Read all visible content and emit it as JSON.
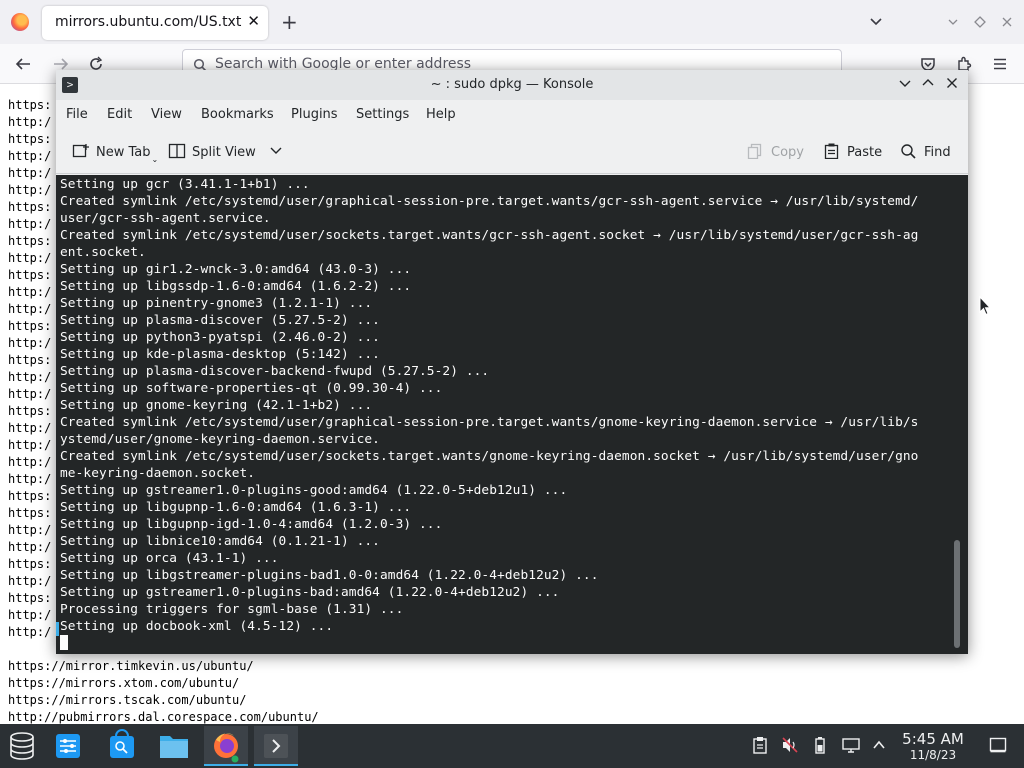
{
  "browser": {
    "tab_title": "mirrors.ubuntu.com/US.txt",
    "tab_close": "✕",
    "new_tab": "+",
    "url_placeholder": "Search with Google or enter address",
    "page_lines": [
      "https:",
      "http:/",
      "https:",
      "http:/",
      "http:/",
      "http:/",
      "https:",
      "http:/",
      "https:",
      "http:/",
      "https:",
      "http:/",
      "http:/",
      "https:",
      "http:/",
      "https:",
      "http:/",
      "http:/",
      "https:",
      "http:/",
      "http:/",
      "http:/",
      "http:/",
      "https:",
      "https:",
      "http:/",
      "http:/",
      "https:",
      "http:/",
      "https:",
      "http:/",
      "http:/"
    ],
    "page_lines_bottom": [
      "https://mirror.timkevin.us/ubuntu/",
      "https://mirrors.xtom.com/ubuntu/",
      "https://mirrors.tscak.com/ubuntu/",
      "http://pubmirrors.dal.corespace.com/ubuntu/"
    ]
  },
  "konsole": {
    "title": "~ : sudo dpkg — Konsole",
    "menu": [
      "File",
      "Edit",
      "View",
      "Bookmarks",
      "Plugins",
      "Settings",
      "Help"
    ],
    "toolbar": {
      "new_tab": "New Tab",
      "split_view": "Split View",
      "copy": "Copy",
      "paste": "Paste",
      "find": "Find"
    },
    "terminal_lines": [
      "Setting up gcr (3.41.1-1+b1) ...",
      "Created symlink /etc/systemd/user/graphical-session-pre.target.wants/gcr-ssh-agent.service → /usr/lib/systemd/",
      "user/gcr-ssh-agent.service.",
      "Created symlink /etc/systemd/user/sockets.target.wants/gcr-ssh-agent.socket → /usr/lib/systemd/user/gcr-ssh-ag",
      "ent.socket.",
      "Setting up gir1.2-wnck-3.0:amd64 (43.0-3) ...",
      "Setting up libgssdp-1.6-0:amd64 (1.6.2-2) ...",
      "Setting up pinentry-gnome3 (1.2.1-1) ...",
      "Setting up plasma-discover (5.27.5-2) ...",
      "Setting up python3-pyatspi (2.46.0-2) ...",
      "Setting up kde-plasma-desktop (5:142) ...",
      "Setting up plasma-discover-backend-fwupd (5.27.5-2) ...",
      "Setting up software-properties-qt (0.99.30-4) ...",
      "Setting up gnome-keyring (42.1-1+b2) ...",
      "Created symlink /etc/systemd/user/graphical-session-pre.target.wants/gnome-keyring-daemon.service → /usr/lib/s",
      "ystemd/user/gnome-keyring-daemon.service.",
      "Created symlink /etc/systemd/user/sockets.target.wants/gnome-keyring-daemon.socket → /usr/lib/systemd/user/gno",
      "me-keyring-daemon.socket.",
      "Setting up gstreamer1.0-plugins-good:amd64 (1.22.0-5+deb12u1) ...",
      "Setting up libgupnp-1.6-0:amd64 (1.6.3-1) ...",
      "Setting up libgupnp-igd-1.0-4:amd64 (1.2.0-3) ...",
      "Setting up libnice10:amd64 (0.1.21-1) ...",
      "Setting up orca (43.1-1) ...",
      "Setting up libgstreamer-plugins-bad1.0-0:amd64 (1.22.0-4+deb12u2) ...",
      "Setting up gstreamer1.0-plugins-bad:amd64 (1.22.0-4+deb12u2) ...",
      "Processing triggers for sgml-base (1.31) ...",
      "Setting up docbook-xml (4.5-12) ..."
    ]
  },
  "taskbar": {
    "time": "5:45 AM",
    "date": "11/8/23"
  },
  "icons": [
    "firefox-icon",
    "close-icon",
    "plus-icon",
    "chevron-down-icon",
    "minimize-icon",
    "maximize-icon",
    "back-icon",
    "forward-icon",
    "reload-icon",
    "search-icon",
    "pocket-icon",
    "extensions-icon",
    "menu-icon",
    "konsole-icon",
    "new-tab-icon",
    "split-view-icon",
    "copy-icon",
    "paste-icon",
    "find-icon",
    "app-launcher-icon",
    "system-settings-icon",
    "discover-icon",
    "file-manager-icon",
    "clipboard-icon",
    "volume-muted-icon",
    "battery-icon",
    "network-icon",
    "expand-tray-icon",
    "show-desktop-icon",
    "mouse-pointer-icon"
  ],
  "colors": {
    "terminal_bg": "#232627",
    "terminal_fg": "#fcfcfc",
    "accent": "#3daee9",
    "taskbar_bg": "#2b3034"
  }
}
